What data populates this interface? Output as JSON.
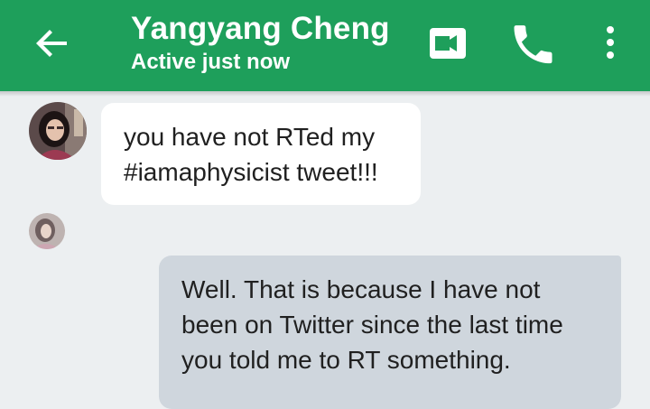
{
  "header": {
    "contact_name": "Yangyang Cheng",
    "status": "Active just now",
    "background_color": "#1e9f5b",
    "icons": [
      "back-arrow-icon",
      "video-call-icon",
      "phone-icon",
      "more-vert-icon"
    ]
  },
  "messages": [
    {
      "direction": "incoming",
      "lines": [
        "you have not RTed my",
        "#iamaphysicist tweet!!!"
      ]
    },
    {
      "direction": "outgoing",
      "lines": [
        "Well. That is because I have not",
        "been on Twitter since the last time",
        "you told me to RT something."
      ]
    }
  ],
  "colors": {
    "chat_background": "#eceff1",
    "incoming_bubble": "#ffffff",
    "outgoing_bubble": "#cfd6dd"
  }
}
